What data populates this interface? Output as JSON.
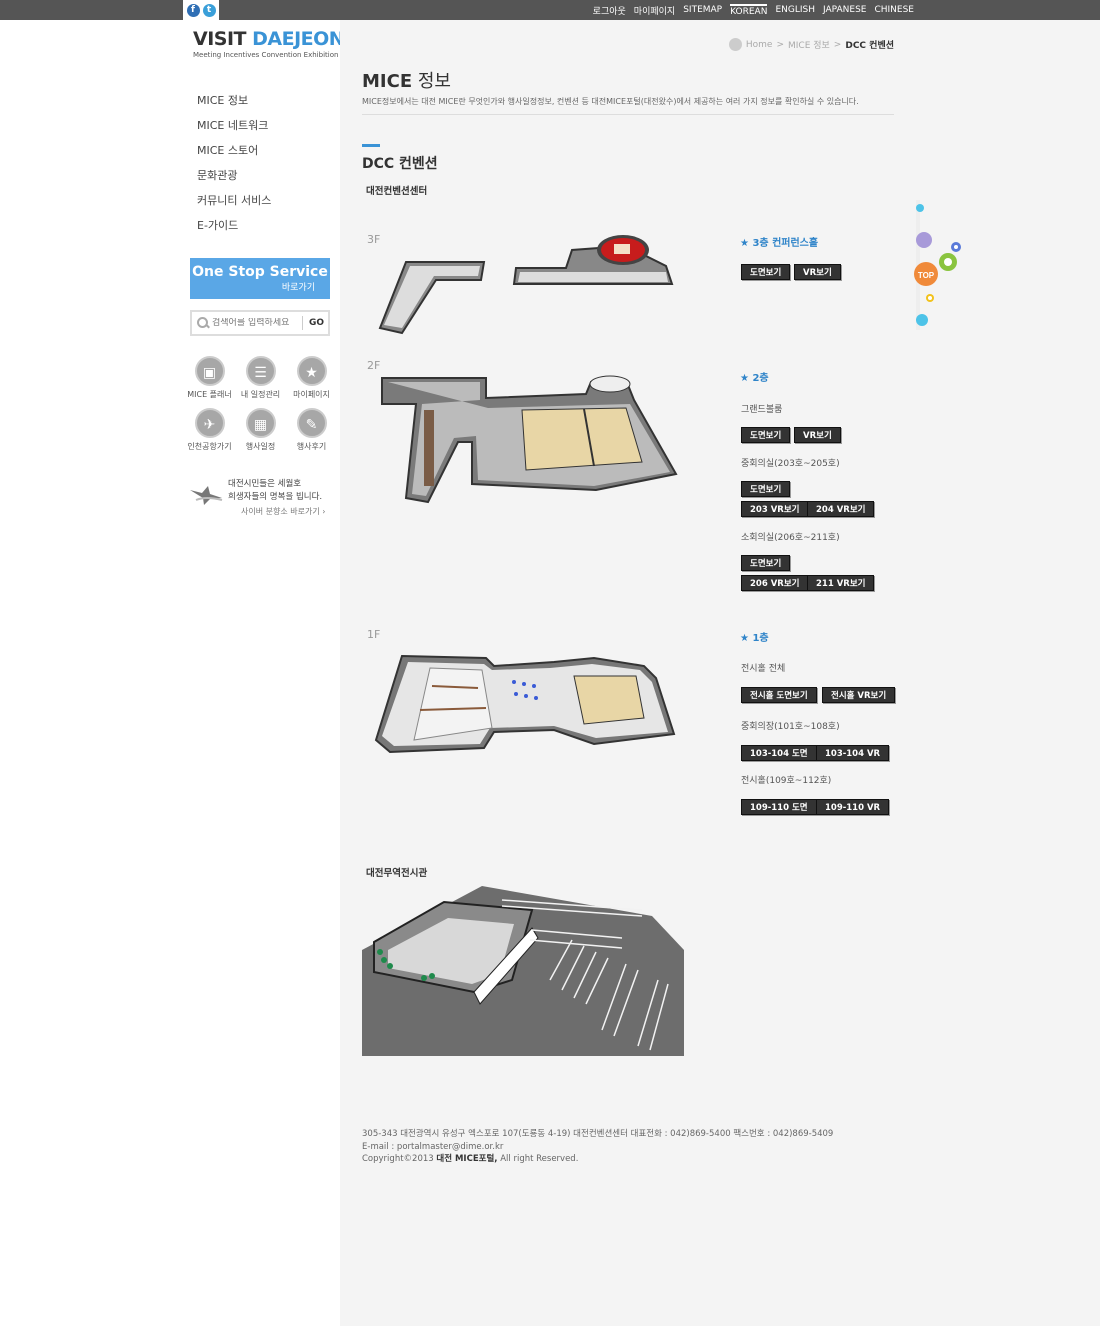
{
  "topbar": {
    "sns": [
      {
        "icon": "facebook-icon",
        "glyph": "f"
      },
      {
        "icon": "twitter-icon",
        "glyph": "t"
      }
    ],
    "links": [
      "로그아웃",
      "마이페이지",
      "SITEMAP",
      "KOREAN",
      "ENGLISH",
      "JAPANESE",
      "CHINESE"
    ],
    "active": "KOREAN"
  },
  "logo": {
    "line1a": "VISIT ",
    "line1b": "DAEJEON",
    "line2": "Meeting Incentives Convention Exhibition"
  },
  "sidebar": {
    "nav": [
      "MICE 정보",
      "MICE 네트워크",
      "MICE 스토어",
      "문화관광",
      "커뮤니티 서비스",
      "E-가이드"
    ],
    "one_stop": {
      "title": "One Stop Service",
      "sub": "바로가기"
    },
    "search": {
      "placeholder": "검색어를 입력하세요",
      "go": "GO"
    },
    "quick": [
      {
        "label": "MICE 플래너",
        "icon": "planner-icon",
        "glyph": "▣"
      },
      {
        "label": "내 일정관리",
        "icon": "schedule-icon",
        "glyph": "☰"
      },
      {
        "label": "마이페이지",
        "icon": "star-icon",
        "glyph": "★"
      },
      {
        "label": "인천공항가기",
        "icon": "airplane-icon",
        "glyph": "✈"
      },
      {
        "label": "행사일정",
        "icon": "calendar-icon",
        "glyph": "▦"
      },
      {
        "label": "행사후기",
        "icon": "pencil-icon",
        "glyph": "✎"
      }
    ],
    "memorial": {
      "line1": "대전시민들은 세월호",
      "line2": "희생자들의 명복을 빕니다.",
      "link": "사이버 분향소 바로가기 ›"
    }
  },
  "breadcrumb": {
    "home": "Home",
    "sep1": ">",
    "level1": "MICE 정보",
    "sep2": ">",
    "current": "DCC 컨벤션"
  },
  "page": {
    "title_a": "MICE",
    "title_b": " 정보",
    "desc": "MICE정보에서는 대전 MICE란 무엇인가와 행사일정정보, 컨벤션 등 대전MICE포털(대전왔수)에서 제공하는 여러 가지 정보를 확인하실 수 있습니다.",
    "section_title": "DCC 컨벤션",
    "sub1": "대전컨벤션센터",
    "sub2": "대전무역전시관"
  },
  "floors": {
    "f3": {
      "tag": "3F",
      "heading": "★ 3층 컨퍼런스홀",
      "buttons": [
        "도면보기",
        "VR보기"
      ]
    },
    "f2": {
      "tag": "2F",
      "heading": "★ 2층",
      "groups": [
        {
          "label": "그랜드볼룸",
          "buttons": [
            "도면보기",
            "VR보기"
          ]
        },
        {
          "label": "중회의실(203호~205호)",
          "buttons": [
            "도면보기",
            "203 VR보기",
            "204 VR보기"
          ]
        },
        {
          "label": "소회의실(206호~211호)",
          "buttons": [
            "도면보기",
            "206 VR보기",
            "211 VR보기"
          ]
        }
      ]
    },
    "f1": {
      "tag": "1F",
      "heading": "★ 1층",
      "groups": [
        {
          "label": "전시홀 전체",
          "buttons": [
            "전시홀 도면보기",
            "전시홀 VR보기"
          ]
        },
        {
          "label": "중회의장(101호~108호)",
          "buttons": [
            "103-104 도면",
            "103-104 VR"
          ]
        },
        {
          "label": "전시홀(109호~112호)",
          "buttons": [
            "109-110 도면",
            "109-110 VR"
          ]
        }
      ]
    }
  },
  "footer": {
    "line1": "305-343 대전광역시 유성구 엑스포로 107(도룡동 4-19) 대전컨벤션센터 대표전화 : 042)869-5400 팩스번호 : 042)869-5409",
    "line2": "E-mail : portalmaster@dime.or.kr",
    "line3a": "Copyright©2013 ",
    "line3b": "대전 MICE포털,",
    "line3c": " All right Reserved."
  },
  "side_tab": {
    "label": "TOP"
  }
}
